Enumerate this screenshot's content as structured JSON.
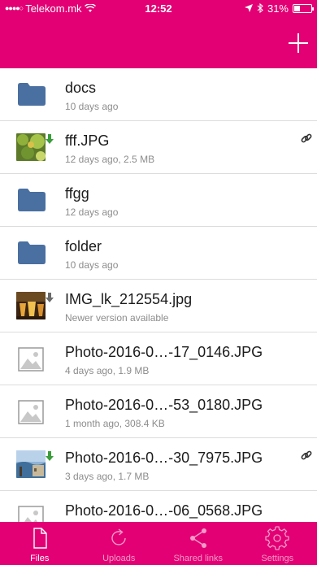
{
  "status_bar": {
    "signal_dots": "●●●●○",
    "carrier": "Telekom.mk",
    "time": "12:52",
    "battery": "31%"
  },
  "colors": {
    "brand": "#e20074",
    "folder": "#4a6fa1",
    "badge_green": "#3a9d3a",
    "badge_gray": "#6a6a6a"
  },
  "files": [
    {
      "name": "docs",
      "meta": "10 days ago",
      "kind": "folder"
    },
    {
      "name": "fff.JPG",
      "meta": "12 days ago, 2.5 MB",
      "kind": "photo-leaves",
      "badge": "download-arrow-icon-green",
      "shared": true
    },
    {
      "name": "ffgg",
      "meta": "12 days ago",
      "kind": "folder"
    },
    {
      "name": "folder",
      "meta": "10 days ago",
      "kind": "folder"
    },
    {
      "name": "IMG_lk_212554.jpg",
      "meta": "Newer version available",
      "kind": "photo-drinks",
      "badge": "download-arrow-icon-gray"
    },
    {
      "name": "Photo-2016-0…-17_0146.JPG",
      "meta": "4 days ago, 1.9 MB",
      "kind": "image-placeholder"
    },
    {
      "name": "Photo-2016-0…-53_0180.JPG",
      "meta": "1 month ago, 308.4 KB",
      "kind": "image-placeholder"
    },
    {
      "name": "Photo-2016-0…-30_7975.JPG",
      "meta": "3 days ago, 1.7 MB",
      "kind": "photo-seaside",
      "badge": "download-arrow-icon-green",
      "shared": true
    },
    {
      "name": "Photo-2016-0…-06_0568.JPG",
      "meta": "",
      "kind": "image-placeholder"
    }
  ],
  "tabs": [
    {
      "label": "Files",
      "icon": "document-icon",
      "active": true
    },
    {
      "label": "Uploads",
      "icon": "refresh-icon",
      "active": false
    },
    {
      "label": "Shared links",
      "icon": "share-icon",
      "active": false
    },
    {
      "label": "Settings",
      "icon": "gear-icon",
      "active": false
    }
  ]
}
